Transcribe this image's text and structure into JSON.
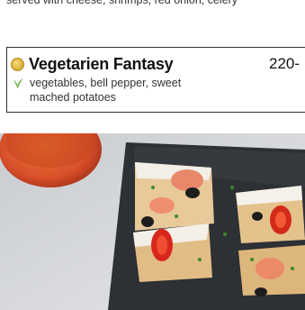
{
  "previous_item": {
    "description": "served with cheese, shrimps, red onion, celery"
  },
  "menu_item": {
    "name": "Vegetarien Fantasy",
    "price": "220-",
    "description": "vegetables, bell pepper, sweet mached potatoes",
    "badge_icon": "gold-medal-icon",
    "diet_icon": "leaf-icon",
    "diet_color": "#5aa62c"
  },
  "photo": {
    "subject": "focaccia-pieces-on-slate-board-photo"
  }
}
